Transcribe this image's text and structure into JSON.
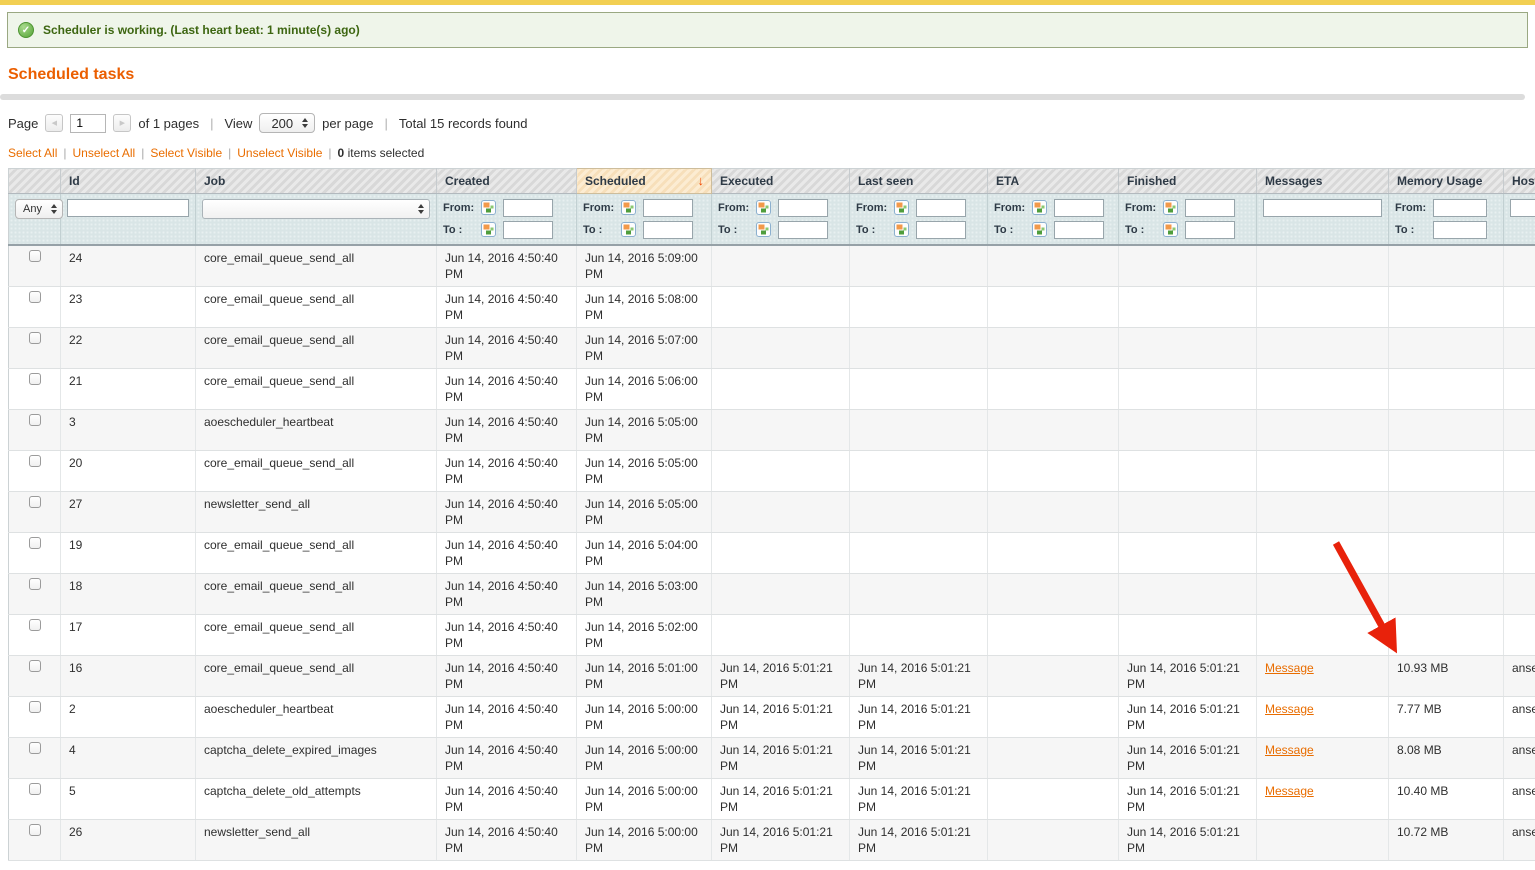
{
  "icons": {
    "success_check": "✓",
    "sort_desc": "↓",
    "prev_arrow": "◀",
    "next_arrow": "▶"
  },
  "colors": {
    "topbar": "#f2cf53",
    "accent": "#eb5e00",
    "success_bg": "#eff5ea",
    "success_text": "#3d6611",
    "link": "#e96d00",
    "sort_arrow": "#f04a00",
    "arrow_red": "#e8220b"
  },
  "message": {
    "text": "Scheduler is working. (Last heart beat: 1 minute(s) ago)"
  },
  "page_title": "Scheduled tasks",
  "pager": {
    "page_label": "Page",
    "page_value": "1",
    "of_label": "of 1 pages",
    "view_label": "View",
    "per_page_value": "200",
    "per_page_label": "per page",
    "total_label": "Total 15 records found"
  },
  "massaction": {
    "select_all": "Select All",
    "unselect_all": "Unselect All",
    "select_visible": "Select Visible",
    "unselect_visible": "Unselect Visible",
    "selected_count": "0",
    "selected_label": "items selected"
  },
  "grid": {
    "columns": [
      "Id",
      "Job",
      "Created",
      "Scheduled",
      "Executed",
      "Last seen",
      "ETA",
      "Finished",
      "Messages",
      "Memory Usage",
      "Host"
    ],
    "sorted_column": "Scheduled",
    "sort_direction": "desc",
    "filter": {
      "any_label": "Any",
      "from_label": "From:",
      "to_label": "To :"
    },
    "message_link_label": "Message",
    "rows": [
      {
        "id": "24",
        "job": "core_email_queue_send_all",
        "created": "Jun 14, 2016 4:50:40 PM",
        "scheduled": "Jun 14, 2016 5:09:00 PM"
      },
      {
        "id": "23",
        "job": "core_email_queue_send_all",
        "created": "Jun 14, 2016 4:50:40 PM",
        "scheduled": "Jun 14, 2016 5:08:00 PM"
      },
      {
        "id": "22",
        "job": "core_email_queue_send_all",
        "created": "Jun 14, 2016 4:50:40 PM",
        "scheduled": "Jun 14, 2016 5:07:00 PM"
      },
      {
        "id": "21",
        "job": "core_email_queue_send_all",
        "created": "Jun 14, 2016 4:50:40 PM",
        "scheduled": "Jun 14, 2016 5:06:00 PM"
      },
      {
        "id": "3",
        "job": "aoescheduler_heartbeat",
        "created": "Jun 14, 2016 4:50:40 PM",
        "scheduled": "Jun 14, 2016 5:05:00 PM"
      },
      {
        "id": "20",
        "job": "core_email_queue_send_all",
        "created": "Jun 14, 2016 4:50:40 PM",
        "scheduled": "Jun 14, 2016 5:05:00 PM"
      },
      {
        "id": "27",
        "job": "newsletter_send_all",
        "created": "Jun 14, 2016 4:50:40 PM",
        "scheduled": "Jun 14, 2016 5:05:00 PM"
      },
      {
        "id": "19",
        "job": "core_email_queue_send_all",
        "created": "Jun 14, 2016 4:50:40 PM",
        "scheduled": "Jun 14, 2016 5:04:00 PM"
      },
      {
        "id": "18",
        "job": "core_email_queue_send_all",
        "created": "Jun 14, 2016 4:50:40 PM",
        "scheduled": "Jun 14, 2016 5:03:00 PM"
      },
      {
        "id": "17",
        "job": "core_email_queue_send_all",
        "created": "Jun 14, 2016 4:50:40 PM",
        "scheduled": "Jun 14, 2016 5:02:00 PM"
      },
      {
        "id": "16",
        "job": "core_email_queue_send_all",
        "created": "Jun 14, 2016 4:50:40 PM",
        "scheduled": "Jun 14, 2016 5:01:00 PM",
        "executed": "Jun 14, 2016 5:01:21 PM",
        "last_seen": "Jun 14, 2016 5:01:21 PM",
        "finished": "Jun 14, 2016 5:01:21 PM",
        "message": true,
        "memory": "10.93 MB",
        "host": "ansem"
      },
      {
        "id": "2",
        "job": "aoescheduler_heartbeat",
        "created": "Jun 14, 2016 4:50:40 PM",
        "scheduled": "Jun 14, 2016 5:00:00 PM",
        "executed": "Jun 14, 2016 5:01:21 PM",
        "last_seen": "Jun 14, 2016 5:01:21 PM",
        "finished": "Jun 14, 2016 5:01:21 PM",
        "message": true,
        "memory": "7.77 MB",
        "host": "ansem"
      },
      {
        "id": "4",
        "job": "captcha_delete_expired_images",
        "created": "Jun 14, 2016 4:50:40 PM",
        "scheduled": "Jun 14, 2016 5:00:00 PM",
        "executed": "Jun 14, 2016 5:01:21 PM",
        "last_seen": "Jun 14, 2016 5:01:21 PM",
        "finished": "Jun 14, 2016 5:01:21 PM",
        "message": true,
        "memory": "8.08 MB",
        "host": "ansem"
      },
      {
        "id": "5",
        "job": "captcha_delete_old_attempts",
        "created": "Jun 14, 2016 4:50:40 PM",
        "scheduled": "Jun 14, 2016 5:00:00 PM",
        "executed": "Jun 14, 2016 5:01:21 PM",
        "last_seen": "Jun 14, 2016 5:01:21 PM",
        "finished": "Jun 14, 2016 5:01:21 PM",
        "message": true,
        "memory": "10.40 MB",
        "host": "ansem"
      },
      {
        "id": "26",
        "job": "newsletter_send_all",
        "created": "Jun 14, 2016 4:50:40 PM",
        "scheduled": "Jun 14, 2016 5:00:00 PM",
        "executed": "Jun 14, 2016 5:01:21 PM",
        "last_seen": "Jun 14, 2016 5:01:21 PM",
        "finished": "Jun 14, 2016 5:01:21 PM",
        "message": false,
        "memory": "10.72 MB",
        "host": "ansem"
      }
    ]
  }
}
